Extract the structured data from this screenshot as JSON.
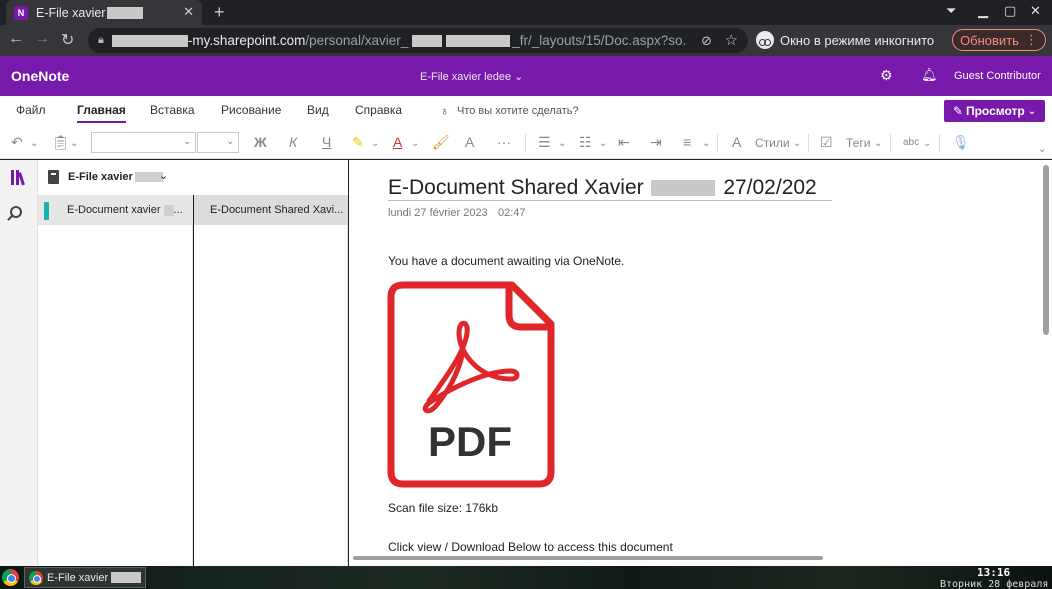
{
  "browser": {
    "tab_title": "E-File xavier",
    "tab_favicon": "N",
    "url_host_suffix": "-my.sharepoint.com",
    "url_path": "/personal/xavier_",
    "url_path_end": "_fr/_layouts/15/Doc.aspx?so...",
    "incognito_label": "Окно в режиме инкогнито",
    "update_label": "Обновить",
    "icons": [
      "back-icon",
      "forward-icon",
      "reload-icon",
      "lock-icon",
      "eye-off-icon",
      "star-icon",
      "incognito-icon",
      "more-icon"
    ]
  },
  "onenote": {
    "app_name": "OneNote",
    "doc_title": "E-File xavier ledee ⌄",
    "guest": "Guest Contributor",
    "ribbon_tabs": [
      "Файл",
      "Главная",
      "Вставка",
      "Рисование",
      "Вид",
      "Справка"
    ],
    "tell_me": "Что вы хотите сделать?",
    "preview_label": "Просмотр",
    "toolbar": {
      "bold": "Ж",
      "italic": "К",
      "underline": "Ч",
      "styles": "Стили",
      "tags": "Теги",
      "spell": "abc"
    },
    "notebook_name": "E-File xavier",
    "section_label": "E-Document xavier",
    "section_label_end": "...",
    "page_label": "E-Document Shared Xavi..."
  },
  "page": {
    "title_start": "E-Document Shared Xavier",
    "title_end": "27/02/202",
    "date": "lundi 27 février 2023",
    "time": "02:47",
    "line1": "You have a document awaiting via OneNote.",
    "pdf_label": "PDF",
    "size_line": "Scan file size: 176kb",
    "line2": "Click view / Download Below to access this document"
  },
  "taskbar": {
    "task_label": "E-File xavier",
    "time": "13:16",
    "date": "Вторник 28 февраля"
  },
  "colors": {
    "brand": "#7719aa",
    "pdf_red": "#e0262b",
    "section_teal": "#1bb1b1",
    "update_red": "#f28b82"
  }
}
